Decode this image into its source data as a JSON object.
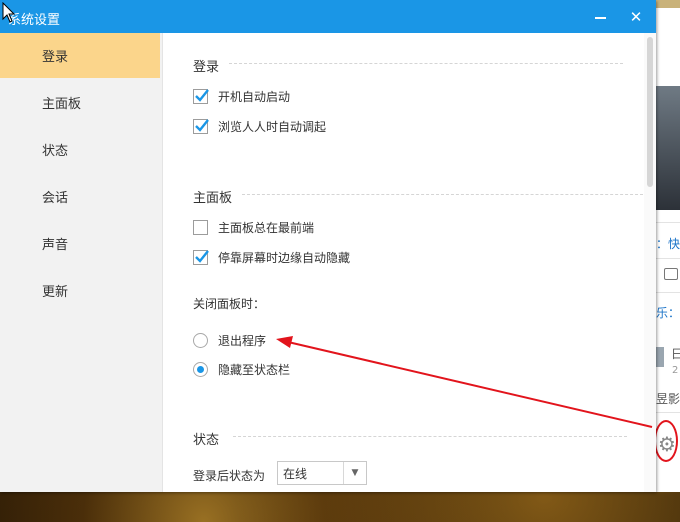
{
  "window": {
    "title": "系统设置",
    "minimize_icon": "minimize-icon",
    "close_icon": "close-icon",
    "close_glyph": "✕"
  },
  "sidebar": {
    "items": [
      {
        "label": "登录",
        "active": true
      },
      {
        "label": "主面板",
        "active": false
      },
      {
        "label": "状态",
        "active": false
      },
      {
        "label": "会话",
        "active": false
      },
      {
        "label": "声音",
        "active": false
      },
      {
        "label": "更新",
        "active": false
      }
    ]
  },
  "login_section": {
    "title": "登录",
    "options": [
      {
        "label": "开机自动启动",
        "checked": true
      },
      {
        "label": "浏览人人时自动调起",
        "checked": true
      }
    ]
  },
  "main_panel_section": {
    "title": "主面板",
    "options": [
      {
        "label": "主面板总在最前端",
        "checked": false
      },
      {
        "label": "停靠屏幕时边缘自动隐藏",
        "checked": true
      }
    ],
    "close_label": "关闭面板时：",
    "close_options": [
      {
        "label": "退出程序",
        "checked": false
      },
      {
        "label": "隐藏至状态栏",
        "checked": true
      }
    ]
  },
  "status_section": {
    "title": "状态",
    "after_login_label": "登录后状态为",
    "after_login_value": "在线"
  },
  "side_app": {
    "text_1": "：快",
    "text_2": "乐：",
    "text_3": "日",
    "text_4": "2",
    "text_5": "昱影",
    "gear_icon": "gear-icon"
  },
  "colors": {
    "titlebar": "#1a96e6",
    "active_nav": "#fbd58b",
    "check": "#1a96e6",
    "annotation": "#e2141c"
  }
}
